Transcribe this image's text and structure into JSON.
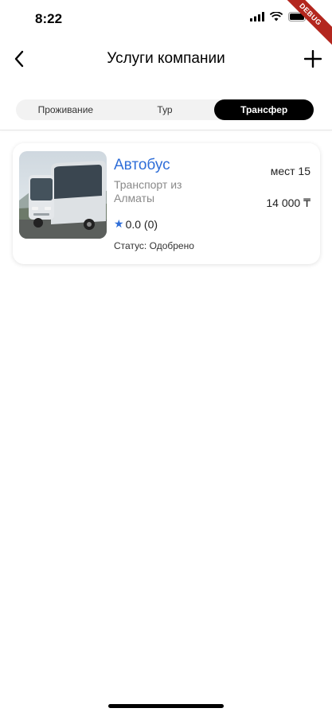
{
  "status_bar": {
    "time": "8:22",
    "debug_label": "DEBUG"
  },
  "app_bar": {
    "title": "Услуги компании"
  },
  "tabs": [
    {
      "label": "Проживание",
      "active": false
    },
    {
      "label": "Тур",
      "active": false
    },
    {
      "label": "Трансфер",
      "active": true
    }
  ],
  "service_card": {
    "title": "Автобус",
    "subtitle": "Транспорт из Алматы",
    "rating": "0.0 (0)",
    "status_label": "Статус:",
    "status_value": "Одобрено",
    "seats": "мест 15",
    "price": "14 000 ₸"
  },
  "colors": {
    "accent": "#2f6ed8",
    "active_tab": "#000000",
    "muted_text": "#8a8a8a"
  },
  "icons": [
    "back-arrow-icon",
    "plus-icon",
    "signal-icon",
    "wifi-icon",
    "battery-icon",
    "star-icon"
  ]
}
